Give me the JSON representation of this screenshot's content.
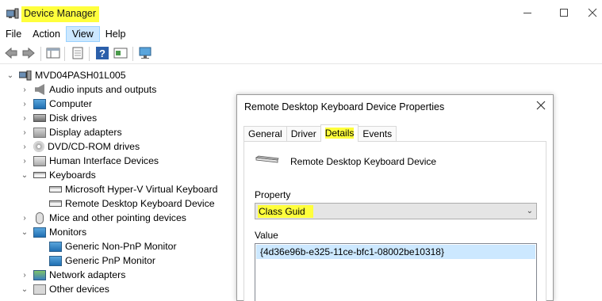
{
  "window": {
    "title": "Device Manager",
    "highlight_color": "#ffff3c"
  },
  "menu": [
    "File",
    "Action",
    "View",
    "Help"
  ],
  "active_menu": "View",
  "tree": {
    "root": "MVD04PASH01L005",
    "items": [
      {
        "label": "Audio inputs and outputs",
        "icon": "speaker-icon"
      },
      {
        "label": "Computer",
        "icon": "computer-icon"
      },
      {
        "label": "Disk drives",
        "icon": "disk-icon"
      },
      {
        "label": "Display adapters",
        "icon": "display-adapter-icon"
      },
      {
        "label": "DVD/CD-ROM drives",
        "icon": "disc-icon"
      },
      {
        "label": "Human Interface Devices",
        "icon": "hid-icon"
      },
      {
        "label": "Keyboards",
        "icon": "keyboard-icon"
      },
      {
        "label": "Microsoft Hyper-V Virtual Keyboard",
        "icon": "keyboard-icon"
      },
      {
        "label": "Remote Desktop Keyboard Device",
        "icon": "keyboard-icon"
      },
      {
        "label": "Mice and other pointing devices",
        "icon": "mouse-icon"
      },
      {
        "label": "Monitors",
        "icon": "monitor-icon"
      },
      {
        "label": "Generic Non-PnP Monitor",
        "icon": "monitor-icon"
      },
      {
        "label": "Generic PnP Monitor",
        "icon": "monitor-icon"
      },
      {
        "label": "Network adapters",
        "icon": "network-icon"
      },
      {
        "label": "Other devices",
        "icon": "other-devices-icon"
      }
    ]
  },
  "dialog": {
    "title": "Remote Desktop Keyboard Device Properties",
    "tabs": [
      "General",
      "Driver",
      "Details",
      "Events"
    ],
    "selected_tab": "Details",
    "device_name": "Remote Desktop Keyboard Device",
    "property_label": "Property",
    "property_value": "Class Guid",
    "value_label": "Value",
    "value": "{4d36e96b-e325-11ce-bfc1-08002be10318}"
  }
}
